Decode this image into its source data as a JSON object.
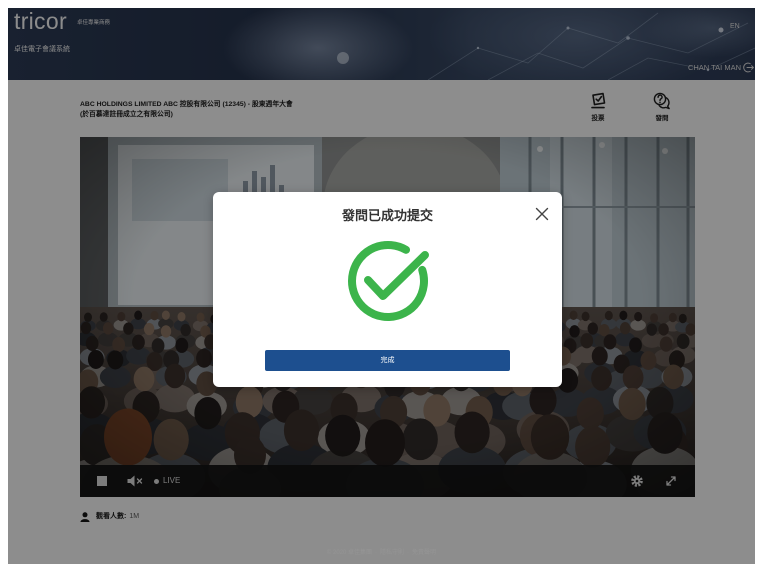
{
  "header": {
    "logo_text": "tricor",
    "logo_tagline": "卓佳專業商務",
    "system_name": "卓佳電子會議系統",
    "language_toggle": "EN",
    "user_name": "CHAN TAI MAN",
    "logout_icon": "logout-icon"
  },
  "meeting": {
    "title": "ABC HOLDINGS LIMITED ABC 控股有限公司 (12345) - 股東週年大會",
    "subtitle": "(於百慕達註冊成立之有限公司)"
  },
  "actions": [
    {
      "label": "投票",
      "icon": "vote-icon"
    },
    {
      "label": "發問",
      "icon": "question-icon"
    }
  ],
  "player": {
    "stop_icon": "stop-icon",
    "volume_icon": "volume-mute-icon",
    "live_indicator_icon": "live-dot-icon",
    "live_label": "LIVE",
    "settings_icon": "gear-icon",
    "fullscreen_icon": "fullscreen-icon"
  },
  "viewers": {
    "icon": "person-icon",
    "label": "觀看人數:",
    "value": "1M"
  },
  "footer": {
    "copyright": "© 2020 卓佳集團",
    "separator": "·",
    "links": [
      "隱私守則",
      "免責聲明"
    ]
  },
  "modal": {
    "title": "發問已成功提交",
    "close_icon": "close-icon",
    "status_icon": "success-check-icon",
    "confirm_label": "完成"
  },
  "colors": {
    "header_bg": "#243149",
    "page_bg": "#f3f3f3",
    "primary_button": "#1d4f8f",
    "success": "#3cb44b",
    "backdrop": "rgba(0,0,0,0.42)"
  }
}
